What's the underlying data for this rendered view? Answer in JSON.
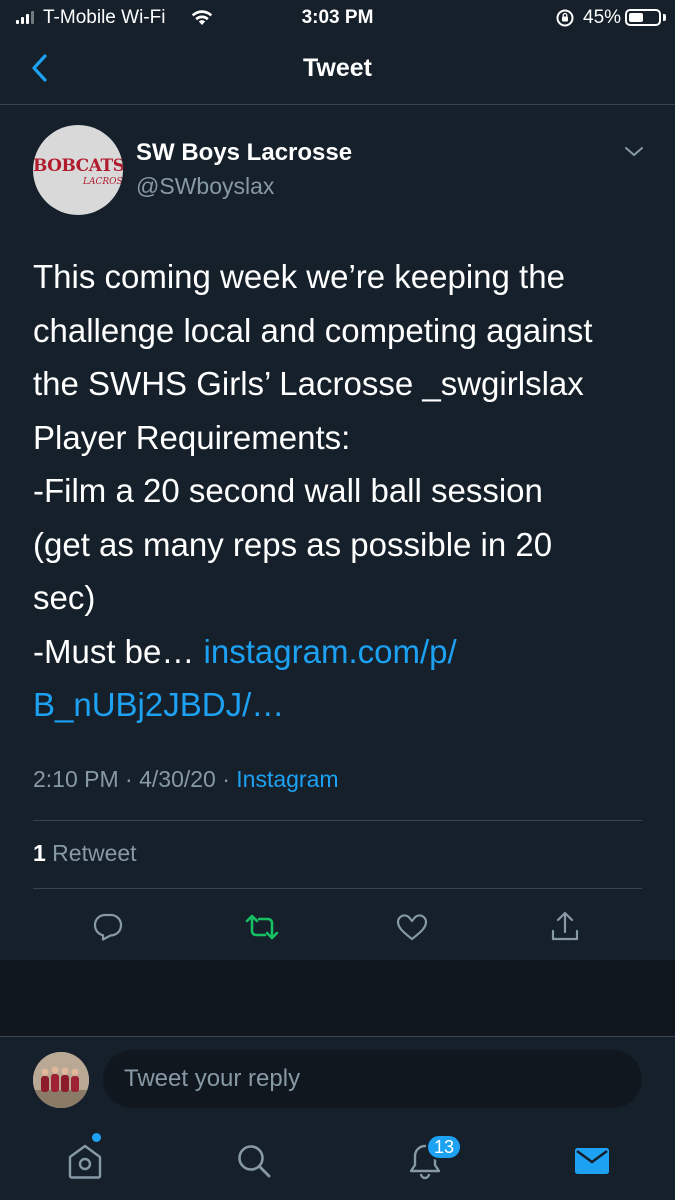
{
  "status_bar": {
    "carrier": "T-Mobile Wi-Fi",
    "time": "3:03 PM",
    "battery_percent": "45%",
    "battery_level": 0.45
  },
  "header": {
    "title": "Tweet",
    "back_icon": "chevron-left-icon"
  },
  "tweet": {
    "author": {
      "name": "SW Boys Lacrosse",
      "handle": "@SWboyslax",
      "avatar_text_top": "BOBCATS",
      "avatar_text_sub": "LACROSSE"
    },
    "text_lines": [
      "This coming week we’re keeping the",
      "challenge local and competing against",
      "the SWHS Girls’ Lacrosse _swgirlslax",
      "Player Requirements:",
      "-Film a 20 second wall ball session",
      "(get as many reps as possible in 20",
      "sec)",
      "-Must be… "
    ],
    "link_part1": "instagram.com/p/",
    "link_part2": "B_nUBj2JBDJ/…",
    "timestamp": "2:10 PM · 4/30/20 · ",
    "source": "Instagram",
    "retweet_count": "1",
    "retweet_label": " Retweet"
  },
  "actions": [
    "reply-icon",
    "retweet-icon",
    "like-icon",
    "share-icon"
  ],
  "reply": {
    "placeholder": "Tweet your reply"
  },
  "tabbar": {
    "notification_count": "13"
  },
  "colors": {
    "background": "#15202b",
    "accent": "#1da1f2",
    "retweet_active": "#17bf63",
    "muted": "#8899a6",
    "divider": "#38444d"
  }
}
